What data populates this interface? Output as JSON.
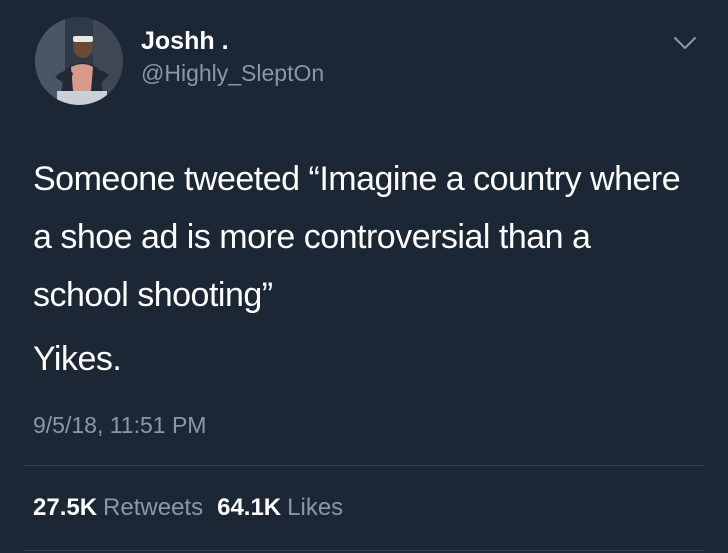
{
  "user": {
    "display_name": "Joshh .",
    "handle": "@Highly_SleptOn"
  },
  "icons": {
    "menu": "chevron-down-icon"
  },
  "tweet": {
    "text_paragraph_1": "Someone tweeted “Imagine a country where a shoe ad is more controversial than a school shooting”",
    "text_paragraph_2": "Yikes.",
    "timestamp": "9/5/18, 11:51 PM"
  },
  "stats": {
    "retweets_count": "27.5K",
    "retweets_label": "Retweets",
    "likes_count": "64.1K",
    "likes_label": "Likes"
  },
  "colors": {
    "background": "#1b2734",
    "primary_text": "#ffffff",
    "secondary_text": "#8899a6",
    "divider": "#38444d"
  }
}
